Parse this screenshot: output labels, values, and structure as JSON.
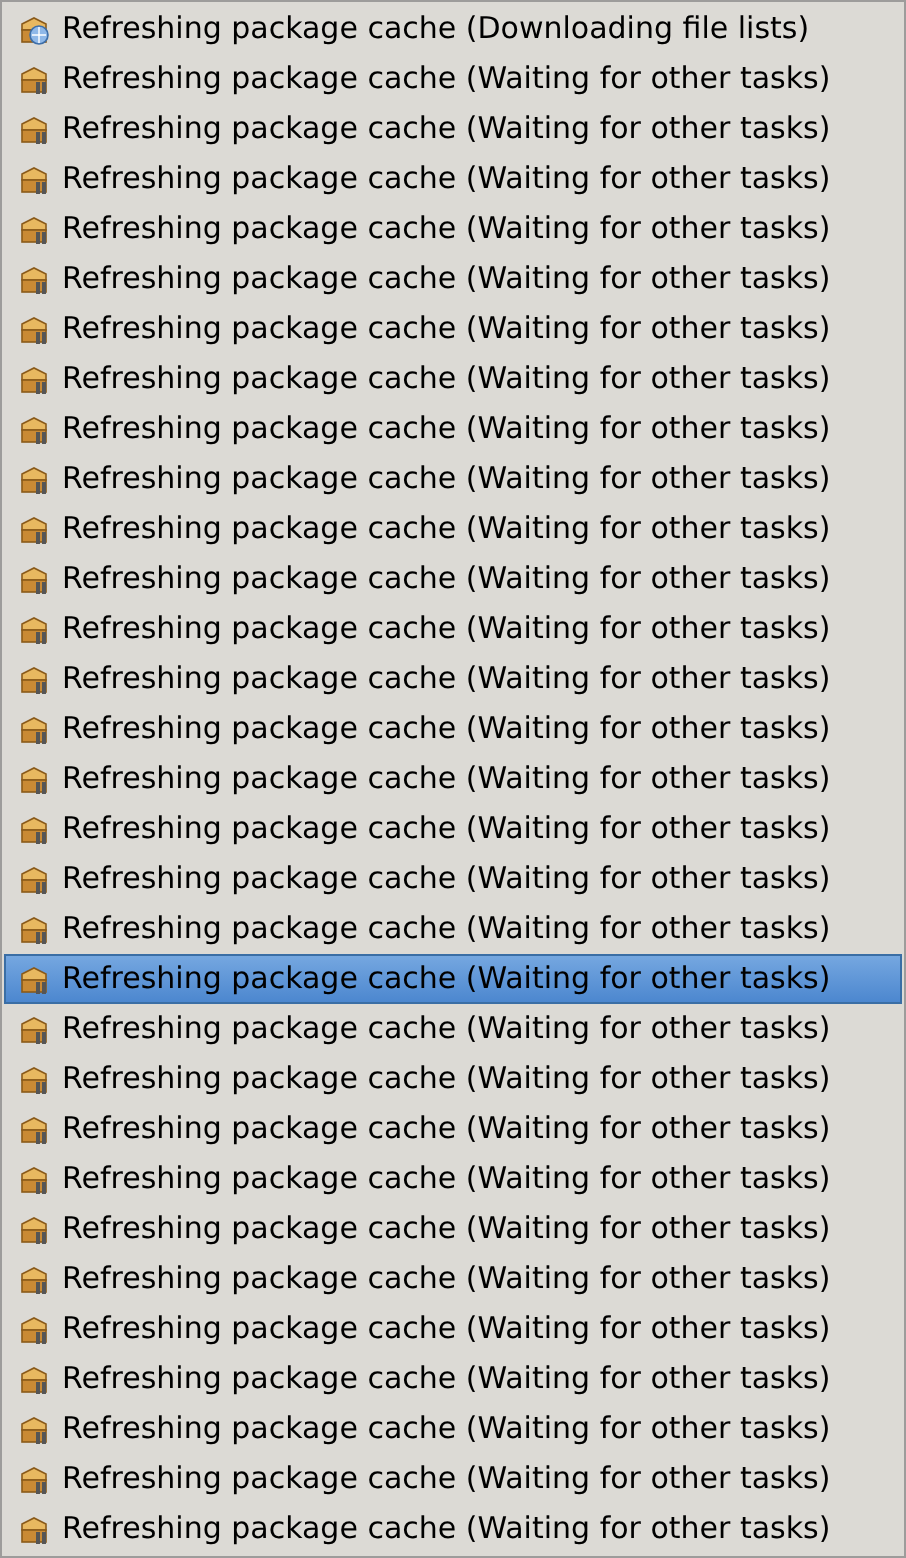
{
  "tasks": [
    {
      "kind": "downloading",
      "label": "Refreshing package cache (Downloading file lists)",
      "selected": false
    },
    {
      "kind": "waiting",
      "label": "Refreshing package cache (Waiting for other tasks)",
      "selected": false
    },
    {
      "kind": "waiting",
      "label": "Refreshing package cache (Waiting for other tasks)",
      "selected": false
    },
    {
      "kind": "waiting",
      "label": "Refreshing package cache (Waiting for other tasks)",
      "selected": false
    },
    {
      "kind": "waiting",
      "label": "Refreshing package cache (Waiting for other tasks)",
      "selected": false
    },
    {
      "kind": "waiting",
      "label": "Refreshing package cache (Waiting for other tasks)",
      "selected": false
    },
    {
      "kind": "waiting",
      "label": "Refreshing package cache (Waiting for other tasks)",
      "selected": false
    },
    {
      "kind": "waiting",
      "label": "Refreshing package cache (Waiting for other tasks)",
      "selected": false
    },
    {
      "kind": "waiting",
      "label": "Refreshing package cache (Waiting for other tasks)",
      "selected": false
    },
    {
      "kind": "waiting",
      "label": "Refreshing package cache (Waiting for other tasks)",
      "selected": false
    },
    {
      "kind": "waiting",
      "label": "Refreshing package cache (Waiting for other tasks)",
      "selected": false
    },
    {
      "kind": "waiting",
      "label": "Refreshing package cache (Waiting for other tasks)",
      "selected": false
    },
    {
      "kind": "waiting",
      "label": "Refreshing package cache (Waiting for other tasks)",
      "selected": false
    },
    {
      "kind": "waiting",
      "label": "Refreshing package cache (Waiting for other tasks)",
      "selected": false
    },
    {
      "kind": "waiting",
      "label": "Refreshing package cache (Waiting for other tasks)",
      "selected": false
    },
    {
      "kind": "waiting",
      "label": "Refreshing package cache (Waiting for other tasks)",
      "selected": false
    },
    {
      "kind": "waiting",
      "label": "Refreshing package cache (Waiting for other tasks)",
      "selected": false
    },
    {
      "kind": "waiting",
      "label": "Refreshing package cache (Waiting for other tasks)",
      "selected": false
    },
    {
      "kind": "waiting",
      "label": "Refreshing package cache (Waiting for other tasks)",
      "selected": false
    },
    {
      "kind": "waiting",
      "label": "Refreshing package cache (Waiting for other tasks)",
      "selected": true
    },
    {
      "kind": "waiting",
      "label": "Refreshing package cache (Waiting for other tasks)",
      "selected": false
    },
    {
      "kind": "waiting",
      "label": "Refreshing package cache (Waiting for other tasks)",
      "selected": false
    },
    {
      "kind": "waiting",
      "label": "Refreshing package cache (Waiting for other tasks)",
      "selected": false
    },
    {
      "kind": "waiting",
      "label": "Refreshing package cache (Waiting for other tasks)",
      "selected": false
    },
    {
      "kind": "waiting",
      "label": "Refreshing package cache (Waiting for other tasks)",
      "selected": false
    },
    {
      "kind": "waiting",
      "label": "Refreshing package cache (Waiting for other tasks)",
      "selected": false
    },
    {
      "kind": "waiting",
      "label": "Refreshing package cache (Waiting for other tasks)",
      "selected": false
    },
    {
      "kind": "waiting",
      "label": "Refreshing package cache (Waiting for other tasks)",
      "selected": false
    },
    {
      "kind": "waiting",
      "label": "Refreshing package cache (Waiting for other tasks)",
      "selected": false
    },
    {
      "kind": "waiting",
      "label": "Refreshing package cache (Waiting for other tasks)",
      "selected": false
    },
    {
      "kind": "waiting",
      "label": "Refreshing package cache (Waiting for other tasks)",
      "selected": false
    }
  ]
}
